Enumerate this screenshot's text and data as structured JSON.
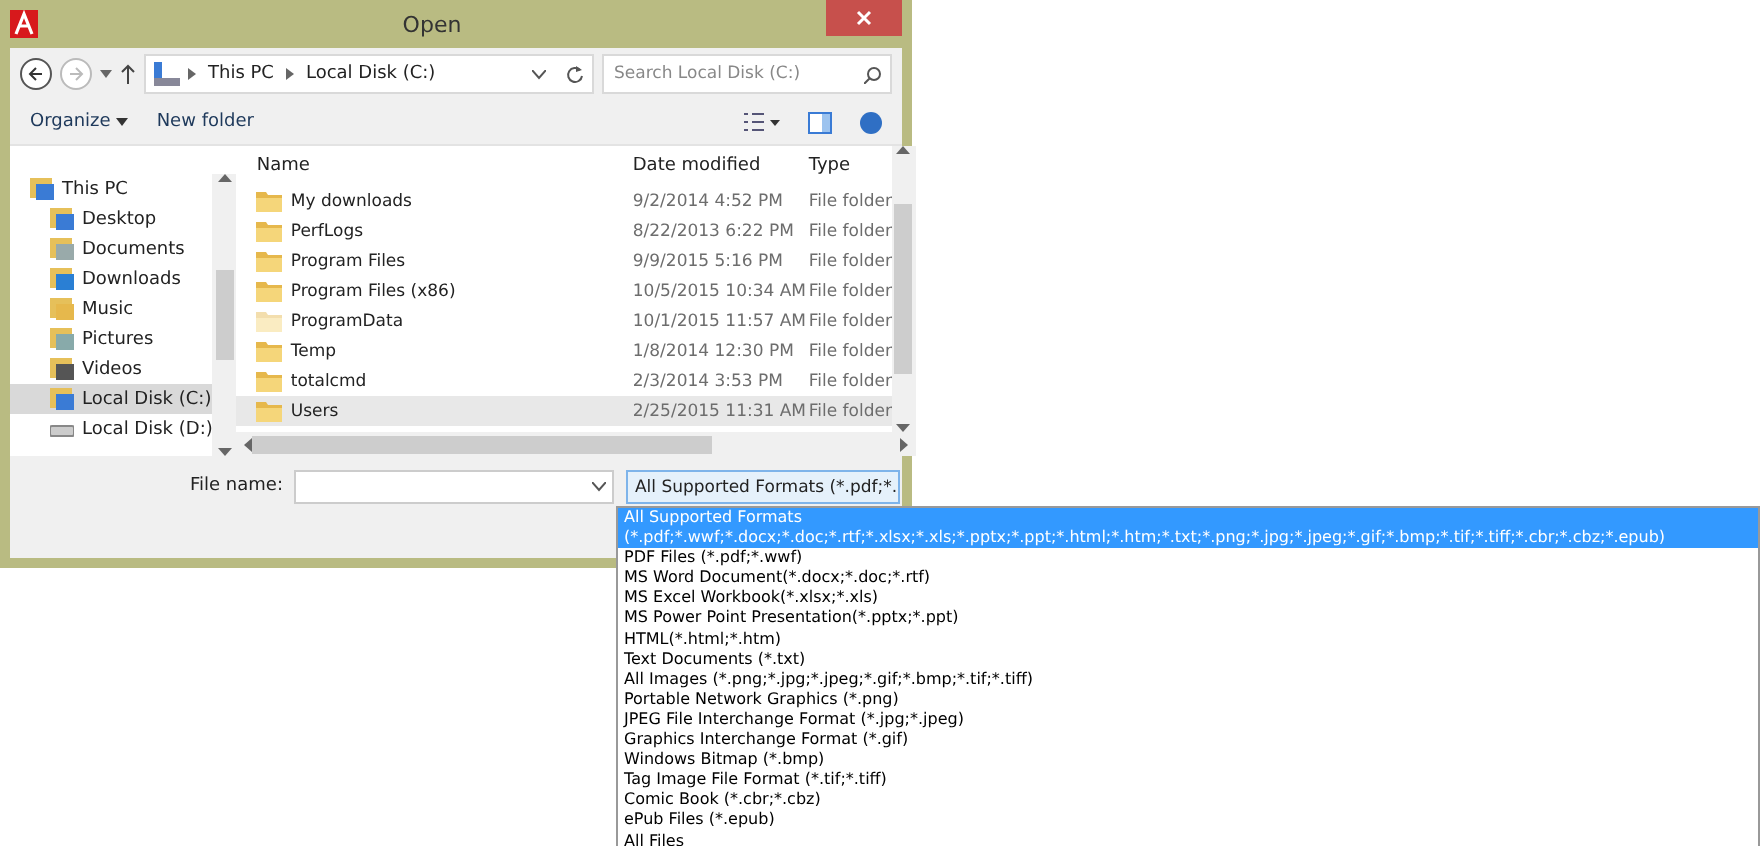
{
  "window": {
    "title": "Open"
  },
  "nav": {
    "back": {
      "disabled": false
    },
    "forward": {
      "disabled": true
    },
    "breadcrumb": [
      "This PC",
      "Local Disk (C:)"
    ],
    "search": {
      "placeholder": "Search Local Disk (C:)"
    }
  },
  "toolbar": {
    "organize": "Organize",
    "new_folder": "New folder"
  },
  "sidebar": {
    "items": [
      {
        "label": "This PC",
        "kind": "computer",
        "selected": false,
        "children": [
          {
            "label": "Desktop",
            "kind": "desktop",
            "selected": false
          },
          {
            "label": "Documents",
            "kind": "documents",
            "selected": false
          },
          {
            "label": "Downloads",
            "kind": "downloads",
            "selected": false
          },
          {
            "label": "Music",
            "kind": "music",
            "selected": false
          },
          {
            "label": "Pictures",
            "kind": "pictures",
            "selected": false
          },
          {
            "label": "Videos",
            "kind": "videos",
            "selected": false
          },
          {
            "label": "Local Disk (C:)",
            "kind": "system-drive",
            "selected": true
          },
          {
            "label": "Local Disk (D:)",
            "kind": "drive",
            "selected": false
          }
        ]
      }
    ]
  },
  "table": {
    "columns": [
      "Name",
      "Date modified",
      "Type"
    ],
    "rows": [
      {
        "name": "My downloads",
        "date": "9/2/2014 4:52 PM",
        "type": "File folder",
        "hidden": false,
        "selected": false
      },
      {
        "name": "PerfLogs",
        "date": "8/22/2013 6:22 PM",
        "type": "File folder",
        "hidden": false,
        "selected": false
      },
      {
        "name": "Program Files",
        "date": "9/9/2015 5:16 PM",
        "type": "File folder",
        "hidden": false,
        "selected": false
      },
      {
        "name": "Program Files (x86)",
        "date": "10/5/2015 10:34 AM",
        "type": "File folder",
        "hidden": false,
        "selected": false
      },
      {
        "name": "ProgramData",
        "date": "10/1/2015 11:57 AM",
        "type": "File folder",
        "hidden": true,
        "selected": false
      },
      {
        "name": "Temp",
        "date": "1/8/2014 12:30 PM",
        "type": "File folder",
        "hidden": false,
        "selected": false
      },
      {
        "name": "totalcmd",
        "date": "2/3/2014 3:53 PM",
        "type": "File folder",
        "hidden": false,
        "selected": false
      },
      {
        "name": "Users",
        "date": "2/25/2015 11:31 AM",
        "type": "File folder",
        "hidden": false,
        "selected": true
      }
    ]
  },
  "file_name": {
    "label": "File name:"
  },
  "file_type": {
    "value": "All Supported Formats (*.pdf;*.",
    "expanded": true,
    "options": [
      {
        "label": "All Supported Formats (*.pdf;*.wwf;*.docx;*.doc;*.rtf;*.xlsx;*.xls;*.pptx;*.ppt;*.html;*.htm;*.txt;*.png;*.jpg;*.jpeg;*.gif;*.bmp;*.tif;*.tiff;*.cbr;*.cbz;*.epub)",
        "selected": true
      },
      {
        "label": "PDF Files (*.pdf;*.wwf)",
        "selected": false
      },
      {
        "label": "MS Word Document(*.docx;*.doc;*.rtf)",
        "selected": false
      },
      {
        "label": "MS Excel Workbook(*.xlsx;*.xls)",
        "selected": false
      },
      {
        "label": "MS Power Point Presentation(*.pptx;*.ppt)",
        "selected": false
      },
      {
        "label": "HTML(*.html;*.htm)",
        "selected": false
      },
      {
        "label": "Text Documents (*.txt)",
        "selected": false
      },
      {
        "label": "All Images (*.png;*.jpg;*.jpeg;*.gif;*.bmp;*.tif;*.tiff)",
        "selected": false
      },
      {
        "label": "Portable Network Graphics (*.png)",
        "selected": false
      },
      {
        "label": "JPEG File Interchange Format (*.jpg;*.jpeg)",
        "selected": false
      },
      {
        "label": "Graphics Interchange Format (*.gif)",
        "selected": false
      },
      {
        "label": "Windows Bitmap (*.bmp)",
        "selected": false
      },
      {
        "label": "Tag Image File Format (*.tif;*.tiff)",
        "selected": false
      },
      {
        "label": "Comic Book (*.cbr;*.cbz)",
        "selected": false
      },
      {
        "label": "ePub Files (*.epub)",
        "selected": false
      },
      {
        "label": "All Files",
        "selected": false
      }
    ]
  }
}
